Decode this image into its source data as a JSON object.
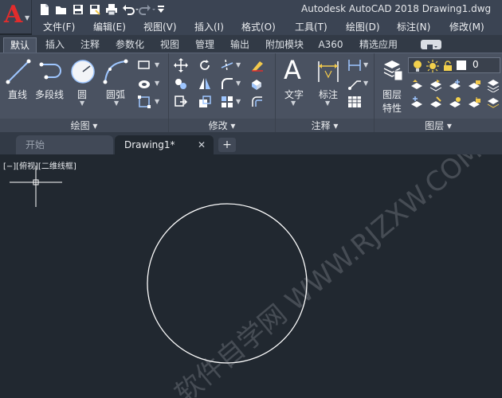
{
  "app": {
    "window_title": "Autodesk AutoCAD 2018    Drawing1.dwg"
  },
  "quick_access": [
    "new-file-icon",
    "open-folder-icon",
    "save-icon",
    "save-as-icon",
    "print-icon",
    "undo-icon",
    "redo-icon",
    "customize-dropdown-icon"
  ],
  "menu": [
    {
      "id": "file",
      "label": "文件(F)"
    },
    {
      "id": "edit",
      "label": "编辑(E)"
    },
    {
      "id": "view",
      "label": "视图(V)"
    },
    {
      "id": "insert",
      "label": "插入(I)"
    },
    {
      "id": "format",
      "label": "格式(O)"
    },
    {
      "id": "tools",
      "label": "工具(T)"
    },
    {
      "id": "draw",
      "label": "绘图(D)"
    },
    {
      "id": "dimension",
      "label": "标注(N)"
    },
    {
      "id": "modify",
      "label": "修改(M)"
    }
  ],
  "ribbon_tabs": [
    {
      "id": "default",
      "label": "默认",
      "active": true
    },
    {
      "id": "insert",
      "label": "插入"
    },
    {
      "id": "annotate",
      "label": "注释"
    },
    {
      "id": "parametric",
      "label": "参数化"
    },
    {
      "id": "view",
      "label": "视图"
    },
    {
      "id": "manage",
      "label": "管理"
    },
    {
      "id": "output",
      "label": "输出"
    },
    {
      "id": "addins",
      "label": "附加模块"
    },
    {
      "id": "a360",
      "label": "A360"
    },
    {
      "id": "featured",
      "label": "精选应用"
    }
  ],
  "panels": {
    "draw": {
      "title": "绘图 ▾",
      "line": "直线",
      "polyline": "多段线",
      "circle": "圆",
      "arc": "圆弧"
    },
    "modify": {
      "title": "修改 ▾"
    },
    "annotation": {
      "title": "注释 ▾",
      "text": "文字",
      "dimension": "标注"
    },
    "layers": {
      "title": "图层 ▾",
      "properties_line1": "图层",
      "properties_line2": "特性",
      "current_layer": "0"
    }
  },
  "file_tabs": [
    {
      "id": "start",
      "label": "开始",
      "active": false
    },
    {
      "id": "drawing1",
      "label": "Drawing1*",
      "active": true
    }
  ],
  "viewport": {
    "label": "[−][俯视][二维线框]"
  },
  "watermark": "软件自学网 WWW.RJZXW.COM",
  "colors": {
    "accent_red": "#e22c2c",
    "canvas_bg": "#212830",
    "ribbon_bg": "#4a5261",
    "circle_stroke": "#ffffff"
  }
}
